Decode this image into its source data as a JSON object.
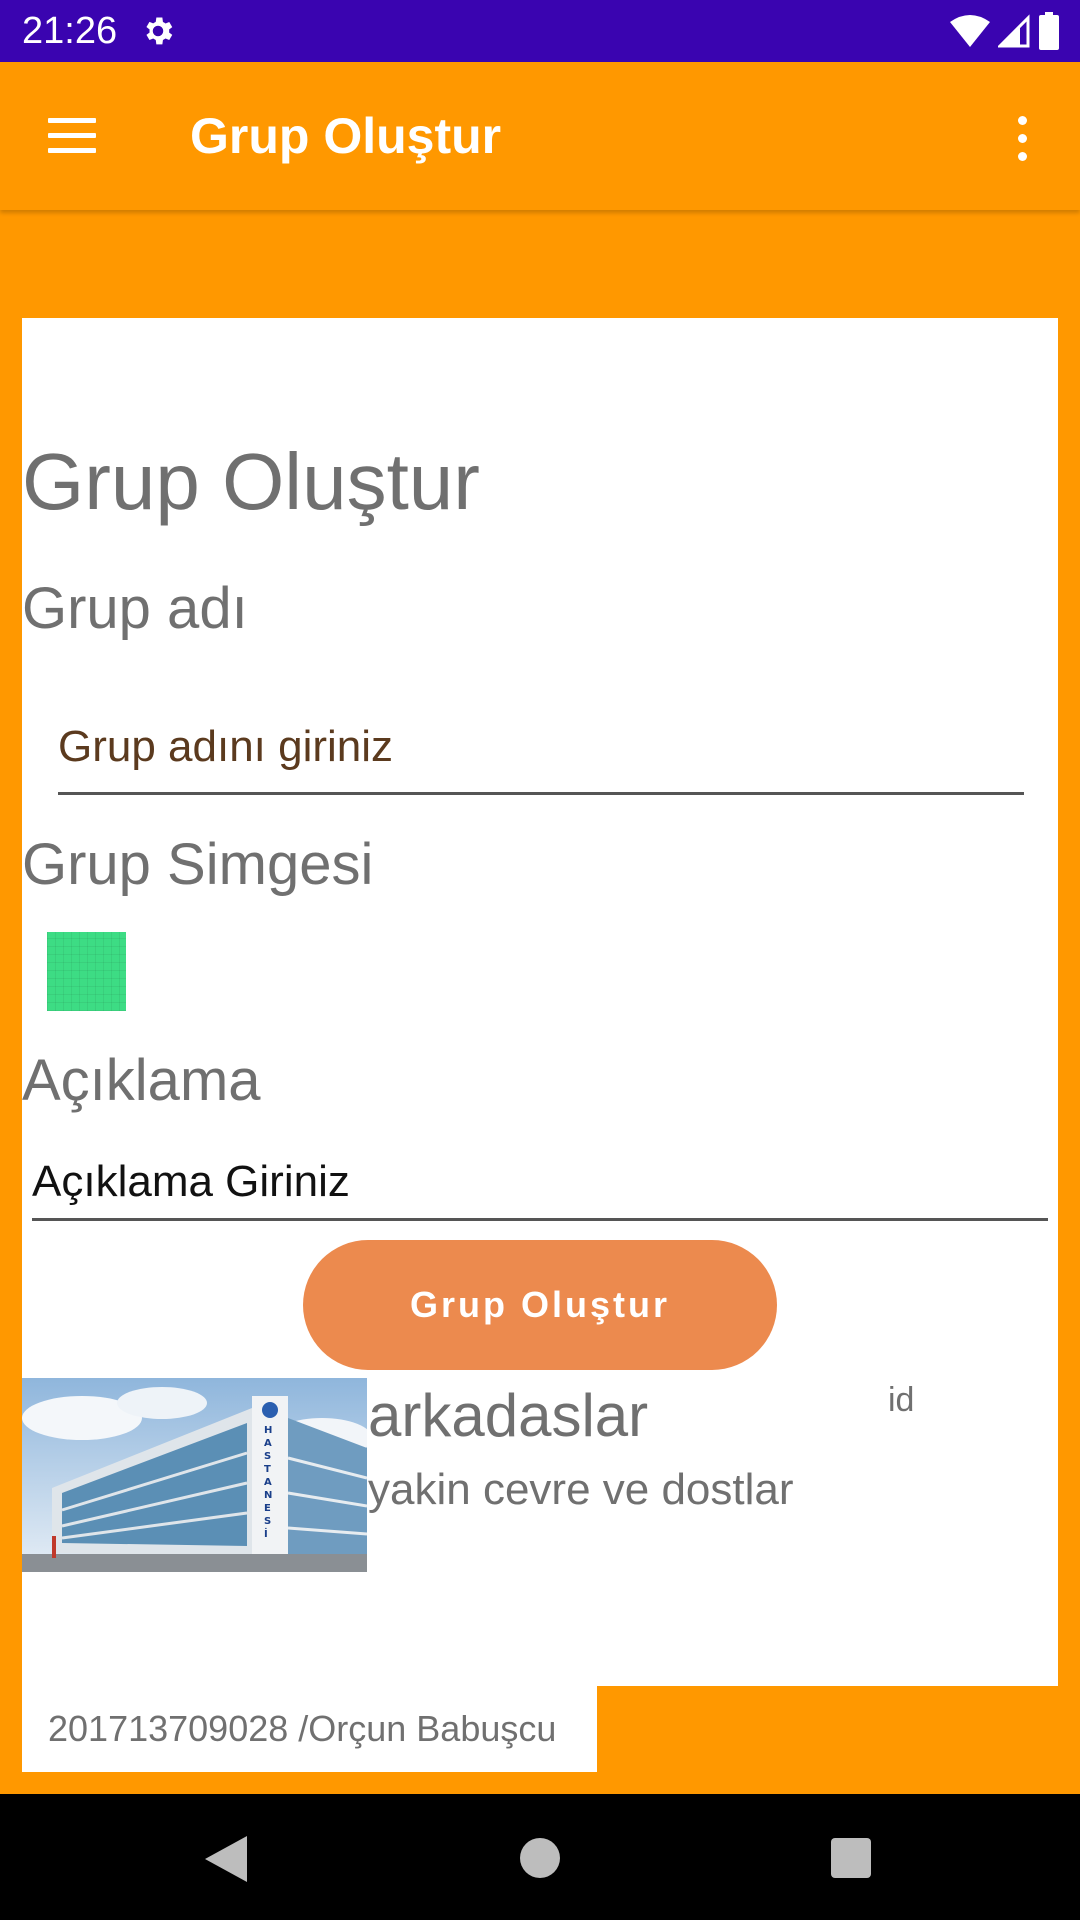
{
  "status_bar": {
    "time": "21:26",
    "icons": [
      "gear-icon",
      "wifi-icon",
      "signal-icon",
      "battery-icon"
    ]
  },
  "app_bar": {
    "title": "Grup Oluştur",
    "icons": [
      "menu-icon",
      "overflow-menu-icon"
    ]
  },
  "form": {
    "heading": "Grup Oluştur",
    "group_name_label": "Grup adı",
    "group_name_placeholder": "Grup adını giriniz",
    "group_icon_label": "Grup Simgesi",
    "group_icon_color": "#3ddc84",
    "description_label": "Açıklama",
    "description_placeholder": "Açıklama Giriniz",
    "submit_label": "Grup Oluştur"
  },
  "group_list": [
    {
      "title": "arkadaslar",
      "description": "yakin cevre ve dostlar",
      "id_label": "id",
      "image": "hospital-building-photo"
    }
  ],
  "footer": {
    "text": "201713709028 /Orçun Babuşcu"
  },
  "colors": {
    "status_bar": "#3a04b0",
    "app_bar": "#ff9800",
    "background": "#ff9800",
    "button": "#ec8a4e"
  },
  "nav_bar": {
    "icons": [
      "back-icon",
      "home-icon",
      "recents-icon"
    ]
  }
}
